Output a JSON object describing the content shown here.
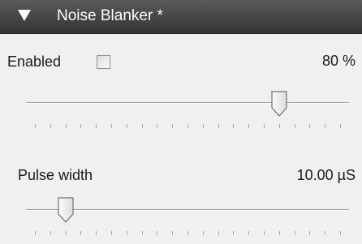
{
  "header": {
    "title": "Noise Blanker *",
    "collapse_icon": "chevron-down-icon"
  },
  "enabled": {
    "label": "Enabled",
    "checked": false,
    "value_text": "80 %",
    "slider_fraction": 0.8
  },
  "pulse_width": {
    "label": "Pulse width",
    "value_text": "10.00 µS",
    "slider_fraction": 0.1
  },
  "colors": {
    "header_bg": "#3c3c3c",
    "panel_bg": "#f0f0f0"
  }
}
